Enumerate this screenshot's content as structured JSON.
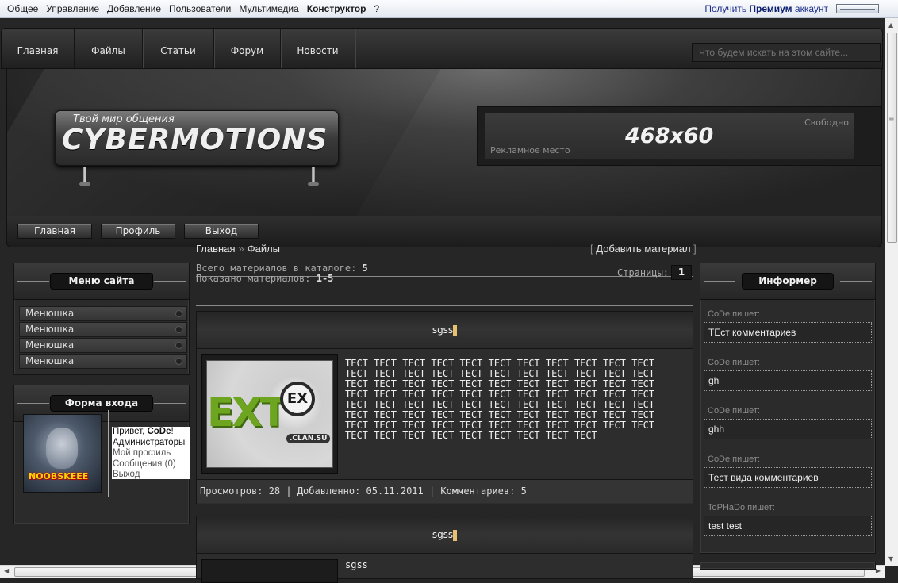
{
  "admin_bar": {
    "menu": [
      "Общее",
      "Управление",
      "Добавление",
      "Пользователи",
      "Мультимедиа",
      "Конструктор",
      "?"
    ],
    "premium_prefix": "Получить",
    "premium_word": "Премиум",
    "premium_suffix": "аккаунт"
  },
  "top_nav": {
    "items": [
      "Главная",
      "Файлы",
      "Статьи",
      "Форум",
      "Новости"
    ],
    "search_placeholder": "Что будем искать на этом сайте..."
  },
  "banner": {
    "tagline": "Твой мир общения",
    "logo": "CYBERMOTIONS",
    "ad_size": "468x60",
    "ad_free": "Свободно",
    "ad_place": "Рекламное место"
  },
  "sub_nav": [
    "Главная",
    "Профиль",
    "Выход"
  ],
  "site_menu": {
    "title": "Меню сайта",
    "items": [
      "Менюшка",
      "Менюшка",
      "Менюшка",
      "Менюшка"
    ]
  },
  "login_form": {
    "title": "Форма входа",
    "avatar_nick": "NOOBSKEEE",
    "greeting_prefix": "Привет, ",
    "user": "CoDe",
    "greeting_suffix": "!",
    "group": "Администраторы",
    "links": [
      "Мой профиль",
      "Сообщения (0)",
      "Выход"
    ]
  },
  "content": {
    "breadcrumb": [
      "Главная",
      "»",
      "Файлы"
    ],
    "add_material": "Добавить материал",
    "total_label": "Всего материалов в каталоге: ",
    "total_value": "5",
    "shown_label": "Показано материалов: ",
    "shown_value": "1-5",
    "pages_label": "Страницы:",
    "page_number": "1",
    "entries": [
      {
        "title": "sgss",
        "text": "ТЕСТ ТЕСТ ТЕСТ ТЕСТ ТЕСТ ТЕСТ ТЕСТ ТЕСТ ТЕСТ ТЕСТ ТЕСТ ТЕСТ ТЕСТ ТЕСТ ТЕСТ ТЕСТ ТЕСТ ТЕСТ ТЕСТ ТЕСТ ТЕСТ ТЕСТ ТЕСТ ТЕСТ ТЕСТ ТЕСТ ТЕСТ ТЕСТ ТЕСТ ТЕСТ ТЕСТ ТЕСТ ТЕСТ ТЕСТ ТЕСТ ТЕСТ ТЕСТ ТЕСТ ТЕСТ ТЕСТ ТЕСТ ТЕСТ ТЕСТ ТЕСТ ТЕСТ ТЕСТ ТЕСТ ТЕСТ ТЕСТ ТЕСТ ТЕСТ ТЕСТ ТЕСТ ТЕСТ ТЕСТ ТЕСТ ТЕСТ ТЕСТ ТЕСТ ТЕСТ ТЕСТ ТЕСТ ТЕСТ ТЕСТ ТЕСТ ТЕСТ ТЕСТ ТЕСТ ТЕСТ ТЕСТ ТЕСТ ТЕСТ ТЕСТ ТЕСТ ТЕСТ ТЕСТ ТЕСТ ТЕСТ ТЕСТ ТЕСТ ТЕСТ ТЕСТ ТЕСТ ТЕСТ ТЕСТ ТЕСТ",
        "thumb_main": "EXT",
        "thumb_ring": "EX",
        "thumb_clan": ".CLAN.SU",
        "meta": "Просмотров: 28 | Добавленно: 05.11.2011 | Комментариев: 5"
      },
      {
        "title": "sgss",
        "text": "sgss"
      }
    ]
  },
  "informer": {
    "title": "Информер",
    "comments": [
      {
        "author": "CoDe пишет:",
        "text": "ТЕст комментариев"
      },
      {
        "author": "CoDe пишет:",
        "text": "gh"
      },
      {
        "author": "CoDe пишет:",
        "text": "ghh"
      },
      {
        "author": "CoDe пишет:",
        "text": "Тест вида комментариев"
      },
      {
        "author": "ToPHaDo пишет:",
        "text": "test test"
      }
    ]
  }
}
